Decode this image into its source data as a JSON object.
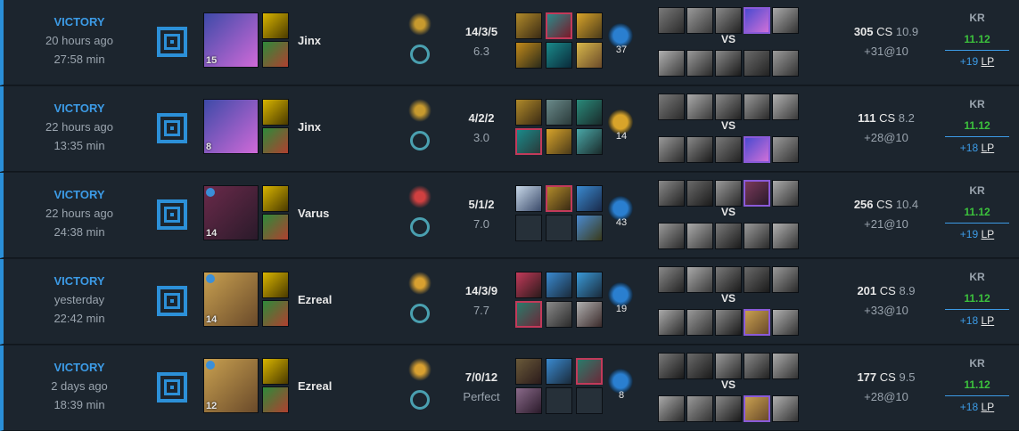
{
  "matches": [
    {
      "result": "VICTORY",
      "when": "20 hours ago",
      "duration": "27:58 min",
      "champion": {
        "name": "Jinx",
        "level": "15",
        "colors": [
          "#3d4aa8",
          "#d06ad8"
        ],
        "checked": false
      },
      "rune_primary_color": "#c79a2e",
      "kda": "14/3/5",
      "kda_ratio": "6.3",
      "items": [
        {
          "c1": "#b08a2a",
          "c2": "#3a2a14"
        },
        {
          "c1": "#2a8a8a",
          "c2": "#7a1a2a",
          "border": "#c23a5a"
        },
        {
          "c1": "#d8a42a",
          "c2": "#4a3a1a"
        },
        {
          "c1": "#c28a1a",
          "c2": "#2a2a1a"
        },
        {
          "c1": "#1a8a8a",
          "c2": "#0a2a3a"
        },
        {
          "c1": "#d8b84a",
          "c2": "#6a4a2a"
        }
      ],
      "ward_count": "37",
      "ward_color": "#2a7fd0",
      "players_top": [
        {
          "c1": "#7a7a7a",
          "c2": "#2a2a2a"
        },
        {
          "c1": "#9a9a9a",
          "c2": "#3a3a3a"
        },
        {
          "c1": "#8a8a8a",
          "c2": "#222222"
        },
        {
          "c1": "#4a4ad0",
          "c2": "#d070d8",
          "border": "#8a5ad8"
        },
        {
          "c1": "#aaaaaa",
          "c2": "#333333"
        }
      ],
      "players_bottom": [
        {
          "c1": "#b0b0b0",
          "c2": "#3a3a3a"
        },
        {
          "c1": "#9a9a9a",
          "c2": "#2a2a2a"
        },
        {
          "c1": "#8a8a8a",
          "c2": "#1a1a1a"
        },
        {
          "c1": "#6a6a6a",
          "c2": "#222222"
        },
        {
          "c1": "#9a9a9a",
          "c2": "#333333"
        }
      ],
      "vs": "VS",
      "cs_value": "305",
      "cs_label": "CS",
      "cs_per_min": "10.9",
      "gold": "+31@10",
      "region": "KR",
      "patch": "11.12",
      "lp_gain": "+19",
      "lp_unit": "LP"
    },
    {
      "result": "VICTORY",
      "when": "22 hours ago",
      "duration": "13:35 min",
      "champion": {
        "name": "Jinx",
        "level": "8",
        "colors": [
          "#3d4aa8",
          "#d06ad8"
        ],
        "checked": false
      },
      "rune_primary_color": "#c79a2e",
      "kda": "4/2/2",
      "kda_ratio": "3.0",
      "items": [
        {
          "c1": "#b08a2a",
          "c2": "#3a2a14"
        },
        {
          "c1": "#6a8a8a",
          "c2": "#2a3a3a"
        },
        {
          "c1": "#2a8a7a",
          "c2": "#1a2a2a"
        },
        {
          "c1": "#1a8a8a",
          "c2": "#2a3a3a",
          "border": "#c23a5a"
        },
        {
          "c1": "#d8a42a",
          "c2": "#4a3a1a"
        },
        {
          "c1": "#4aa8a8",
          "c2": "#1a2a2a"
        }
      ],
      "ward_count": "14",
      "ward_color": "#d8a42a",
      "players_top": [
        {
          "c1": "#7a7a7a",
          "c2": "#2a2a2a"
        },
        {
          "c1": "#aaaaaa",
          "c2": "#3a3a3a"
        },
        {
          "c1": "#8a8a8a",
          "c2": "#222222"
        },
        {
          "c1": "#9a9a9a",
          "c2": "#2a2a2a"
        },
        {
          "c1": "#b0b0b0",
          "c2": "#3a3a3a"
        }
      ],
      "players_bottom": [
        {
          "c1": "#9a9a9a",
          "c2": "#2a2a2a"
        },
        {
          "c1": "#8a8a8a",
          "c2": "#1a1a1a"
        },
        {
          "c1": "#7a7a7a",
          "c2": "#222222"
        },
        {
          "c1": "#4a4ad0",
          "c2": "#d070d8",
          "border": "#8a5ad8"
        },
        {
          "c1": "#9a9a9a",
          "c2": "#333333"
        }
      ],
      "vs": "VS",
      "cs_value": "111",
      "cs_label": "CS",
      "cs_per_min": "8.2",
      "gold": "+28@10",
      "region": "KR",
      "patch": "11.12",
      "lp_gain": "+18",
      "lp_unit": "LP"
    },
    {
      "result": "VICTORY",
      "when": "22 hours ago",
      "duration": "24:38 min",
      "champion": {
        "name": "Varus",
        "level": "14",
        "colors": [
          "#6a2a4a",
          "#2a1a2a"
        ],
        "checked": true
      },
      "rune_primary_color": "#d04040",
      "kda": "5/1/2",
      "kda_ratio": "7.0",
      "items": [
        {
          "c1": "#c8d8e8",
          "c2": "#3a4a6a"
        },
        {
          "c1": "#b08a2a",
          "c2": "#3a2a14",
          "border": "#c23a5a"
        },
        {
          "c1": "#3a8ad0",
          "c2": "#1a2a4a"
        },
        null,
        null,
        {
          "c1": "#4a8ad0",
          "c2": "#3a3a1a"
        }
      ],
      "ward_count": "43",
      "ward_color": "#2a7fd0",
      "players_top": [
        {
          "c1": "#8a8a8a",
          "c2": "#222222"
        },
        {
          "c1": "#6a6a6a",
          "c2": "#1a1a1a"
        },
        {
          "c1": "#9a9a9a",
          "c2": "#2a2a2a"
        },
        {
          "c1": "#7a3a5a",
          "c2": "#2a1a2a",
          "border": "#8a5ad8"
        },
        {
          "c1": "#aaaaaa",
          "c2": "#333333"
        }
      ],
      "players_bottom": [
        {
          "c1": "#9a9a9a",
          "c2": "#2a2a2a"
        },
        {
          "c1": "#aaaaaa",
          "c2": "#3a3a3a"
        },
        {
          "c1": "#7a7a7a",
          "c2": "#1a1a1a"
        },
        {
          "c1": "#9a9a9a",
          "c2": "#2a2a2a"
        },
        {
          "c1": "#b0b0b0",
          "c2": "#333333"
        }
      ],
      "vs": "VS",
      "cs_value": "256",
      "cs_label": "CS",
      "cs_per_min": "10.4",
      "gold": "+21@10",
      "region": "KR",
      "patch": "11.12",
      "lp_gain": "+19",
      "lp_unit": "LP"
    },
    {
      "result": "VICTORY",
      "when": "yesterday",
      "duration": "22:42 min",
      "champion": {
        "name": "Ezreal",
        "level": "14",
        "colors": [
          "#c8a050",
          "#6a4a2a"
        ],
        "checked": true
      },
      "rune_primary_color": "#d8a030",
      "kda": "14/3/9",
      "kda_ratio": "7.7",
      "items": [
        {
          "c1": "#c23a5a",
          "c2": "#2a1a1a"
        },
        {
          "c1": "#3a8ad0",
          "c2": "#1a2a3a"
        },
        {
          "c1": "#3a9ad8",
          "c2": "#1a2a3a"
        },
        {
          "c1": "#2a7a6a",
          "c2": "#6a2a3a",
          "border": "#c23a5a"
        },
        {
          "c1": "#8a8a8a",
          "c2": "#2a2a2a"
        },
        {
          "c1": "#b0b0b0",
          "c2": "#3a2a2a"
        }
      ],
      "ward_count": "19",
      "ward_color": "#2a7fd0",
      "players_top": [
        {
          "c1": "#8a8a8a",
          "c2": "#222222"
        },
        {
          "c1": "#aaaaaa",
          "c2": "#3a3a3a"
        },
        {
          "c1": "#7a7a7a",
          "c2": "#1a1a1a"
        },
        {
          "c1": "#6a6a6a",
          "c2": "#1a1a1a"
        },
        {
          "c1": "#9a9a9a",
          "c2": "#2a2a2a"
        }
      ],
      "players_bottom": [
        {
          "c1": "#aaaaaa",
          "c2": "#2a2a2a"
        },
        {
          "c1": "#9a9a9a",
          "c2": "#333333"
        },
        {
          "c1": "#8a8a8a",
          "c2": "#1a1a1a"
        },
        {
          "c1": "#c8a050",
          "c2": "#6a4a2a",
          "border": "#8a5ad8"
        },
        {
          "c1": "#b0b0b0",
          "c2": "#333333"
        }
      ],
      "vs": "VS",
      "cs_value": "201",
      "cs_label": "CS",
      "cs_per_min": "8.9",
      "gold": "+33@10",
      "region": "KR",
      "patch": "11.12",
      "lp_gain": "+18",
      "lp_unit": "LP"
    },
    {
      "result": "VICTORY",
      "when": "2 days ago",
      "duration": "18:39 min",
      "champion": {
        "name": "Ezreal",
        "level": "12",
        "colors": [
          "#c8a050",
          "#6a4a2a"
        ],
        "checked": true
      },
      "rune_primary_color": "#d8a030",
      "kda": "7/0/12",
      "kda_ratio": "Perfect",
      "items": [
        {
          "c1": "#6a5a3a",
          "c2": "#2a1a1a"
        },
        {
          "c1": "#3a8ad0",
          "c2": "#1a2a3a"
        },
        {
          "c1": "#2a7a6a",
          "c2": "#6a2a3a",
          "border": "#c23a5a"
        },
        {
          "c1": "#8a6a8a",
          "c2": "#2a1a2a"
        },
        null,
        null
      ],
      "ward_count": "8",
      "ward_color": "#2a7fd0",
      "players_top": [
        {
          "c1": "#7a7a7a",
          "c2": "#1a1a1a"
        },
        {
          "c1": "#6a6a6a",
          "c2": "#1a1a1a"
        },
        {
          "c1": "#9a9a9a",
          "c2": "#2a2a2a"
        },
        {
          "c1": "#8a8a8a",
          "c2": "#222222"
        },
        {
          "c1": "#aaaaaa",
          "c2": "#333333"
        }
      ],
      "players_bottom": [
        {
          "c1": "#aaaaaa",
          "c2": "#2a2a2a"
        },
        {
          "c1": "#9a9a9a",
          "c2": "#333333"
        },
        {
          "c1": "#8a8a8a",
          "c2": "#1a1a1a"
        },
        {
          "c1": "#c8a050",
          "c2": "#6a4a2a",
          "border": "#8a5ad8"
        },
        {
          "c1": "#b0b0b0",
          "c2": "#333333"
        }
      ],
      "vs": "VS",
      "cs_value": "177",
      "cs_label": "CS",
      "cs_per_min": "9.5",
      "gold": "+28@10",
      "region": "KR",
      "patch": "11.12",
      "lp_gain": "+18",
      "lp_unit": "LP"
    }
  ]
}
